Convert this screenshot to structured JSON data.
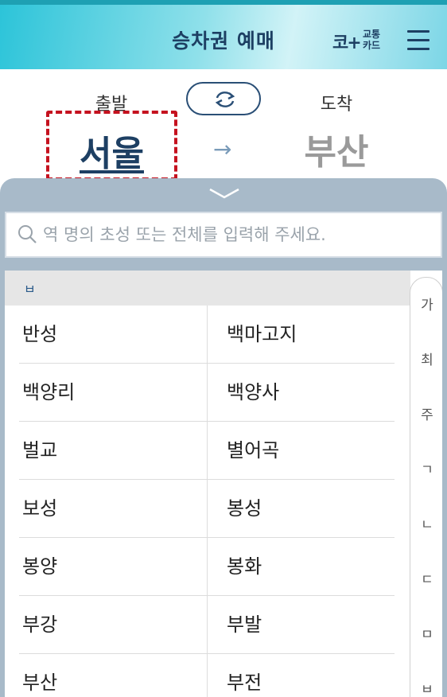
{
  "header": {
    "title": "승차권 예매",
    "card_logo_mark": "코+",
    "card_logo_line1": "교통",
    "card_logo_line2": "카드",
    "menu_icon": "hamburger-menu-icon"
  },
  "route": {
    "departure_label": "출발",
    "arrival_label": "도착",
    "departure_city": "서울",
    "arrival_city": "부산",
    "swap_icon": "swap-arrows-icon",
    "arrow_symbol": "→"
  },
  "panel": {
    "collapse_icon": "chevron-down-icon",
    "search": {
      "icon": "search-icon",
      "placeholder": "역 명의 초성 또는 전체를 입력해 주세요.",
      "value": ""
    },
    "section_header": "ㅂ",
    "stations": [
      [
        "반성",
        "백마고지"
      ],
      [
        "백양리",
        "백양사"
      ],
      [
        "벌교",
        "별어곡"
      ],
      [
        "보성",
        "봉성"
      ],
      [
        "봉양",
        "봉화"
      ],
      [
        "부강",
        "부발"
      ],
      [
        "부산",
        "부전"
      ]
    ],
    "index": [
      "가",
      "최",
      "주",
      "ㄱ",
      "ㄴ",
      "ㄷ",
      "ㅁ",
      "ㅂ"
    ]
  },
  "colors": {
    "accent_navy": "#1d3f63",
    "highlight_red": "#c5121f",
    "panel_bg": "#a8bac9",
    "header_teal": "#2cc4d9"
  }
}
